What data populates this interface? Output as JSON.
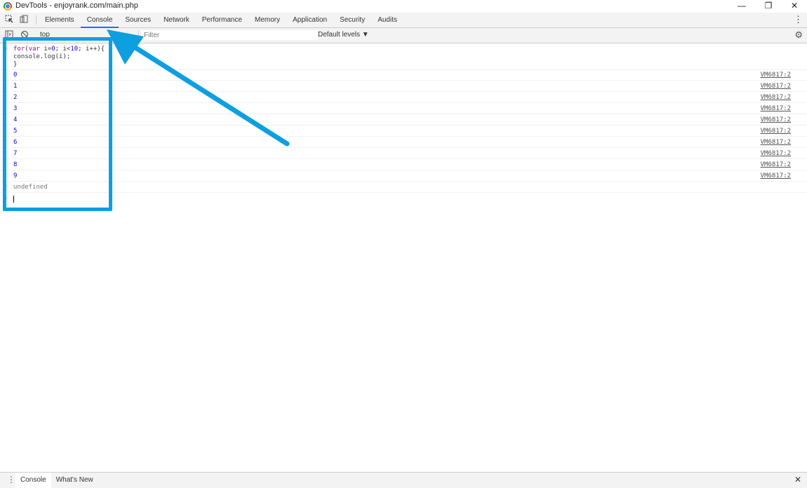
{
  "window": {
    "title": "DevTools - enjoyrank.com/main.php",
    "minimize": "—",
    "restore": "❐",
    "close": "✕"
  },
  "tabs": [
    {
      "label": "Elements"
    },
    {
      "label": "Console"
    },
    {
      "label": "Sources"
    },
    {
      "label": "Network"
    },
    {
      "label": "Performance"
    },
    {
      "label": "Memory"
    },
    {
      "label": "Application"
    },
    {
      "label": "Security"
    },
    {
      "label": "Audits"
    }
  ],
  "active_tab": "Console",
  "toolbar": {
    "context": "top",
    "filter_placeholder": "Filter",
    "levels": "Default levels ▼"
  },
  "console": {
    "input_lines": [
      "for(var i=0; i<10; i++){",
      "console.log(i);",
      "}"
    ],
    "logs": [
      {
        "value": "0",
        "source": "VM6817:2"
      },
      {
        "value": "1",
        "source": "VM6817:2"
      },
      {
        "value": "2",
        "source": "VM6817:2"
      },
      {
        "value": "3",
        "source": "VM6817:2"
      },
      {
        "value": "4",
        "source": "VM6817:2"
      },
      {
        "value": "5",
        "source": "VM6817:2"
      },
      {
        "value": "6",
        "source": "VM6817:2"
      },
      {
        "value": "7",
        "source": "VM6817:2"
      },
      {
        "value": "8",
        "source": "VM6817:2"
      },
      {
        "value": "9",
        "source": "VM6817:2"
      }
    ],
    "result": "undefined"
  },
  "drawer": {
    "tabs": [
      {
        "label": "Console"
      },
      {
        "label": "What's New"
      }
    ],
    "close": "✕"
  },
  "colors": {
    "annotation": "#0d9fe0",
    "accent": "#1a73e8",
    "log_number": "#1c00cf",
    "keyword": "#881391"
  }
}
